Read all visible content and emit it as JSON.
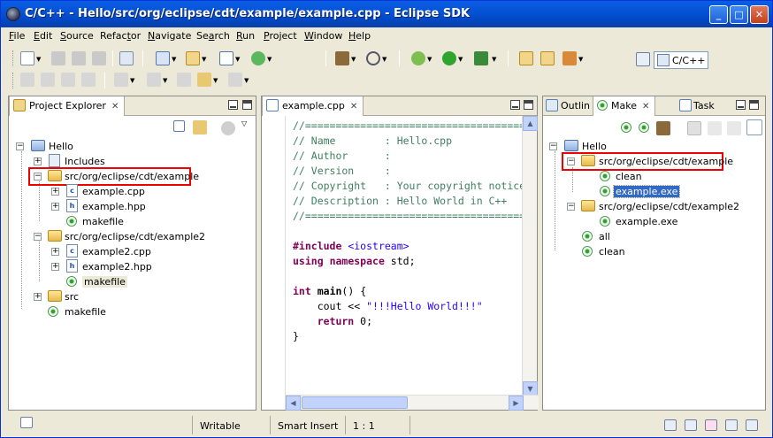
{
  "window": {
    "title": "C/C++ - Hello/src/org/eclipse/cdt/example/example.cpp - Eclipse SDK"
  },
  "menu": [
    "File",
    "Edit",
    "Source",
    "Refactor",
    "Navigate",
    "Search",
    "Run",
    "Project",
    "Window",
    "Help"
  ],
  "menu_mnemonics": [
    "F",
    "E",
    "S",
    "t",
    "N",
    "a",
    "R",
    "P",
    "W",
    "H"
  ],
  "perspective": {
    "label": "C/C++"
  },
  "project_explorer": {
    "title": "Project Explorer",
    "items": [
      {
        "label": "Hello"
      },
      {
        "label": "Includes"
      },
      {
        "label": "src/org/eclipse/cdt/example"
      },
      {
        "label": "example.cpp"
      },
      {
        "label": "example.hpp"
      },
      {
        "label": "makefile"
      },
      {
        "label": "src/org/eclipse/cdt/example2"
      },
      {
        "label": "example2.cpp"
      },
      {
        "label": "example2.hpp"
      },
      {
        "label": "makefile"
      },
      {
        "label": "src"
      },
      {
        "label": "makefile"
      }
    ]
  },
  "editor": {
    "tab": "example.cpp",
    "lines": [
      "//=====================================",
      "// Name        : Hello.cpp",
      "// Author      :",
      "// Version     :",
      "// Copyright   : Your copyright notice",
      "// Description : Hello World in C++",
      "//====================================="
    ],
    "include": {
      "directive": "#include",
      "header": "<iostream>"
    },
    "using": {
      "kw1": "using",
      "kw2": "namespace",
      "rest": " std;"
    },
    "main": {
      "kw": "int",
      "name": "main",
      "rest": "() {"
    },
    "cout": {
      "pre": "    cout << ",
      "str": "\"!!!Hello World!!!\""
    },
    "ret": {
      "kw": "    return",
      "rest": " 0;"
    },
    "close": "}"
  },
  "right_panel": {
    "tabs": [
      "Outlin",
      "Make",
      "Task"
    ],
    "items": [
      {
        "label": "Hello"
      },
      {
        "label": "src/org/eclipse/cdt/example"
      },
      {
        "label": "clean"
      },
      {
        "label": "example.exe"
      },
      {
        "label": "src/org/eclipse/cdt/example2"
      },
      {
        "label": "example.exe"
      },
      {
        "label": "all"
      },
      {
        "label": "clean"
      }
    ]
  },
  "status": {
    "writable": "Writable",
    "insert_mode": "Smart Insert",
    "position": "1 : 1"
  }
}
